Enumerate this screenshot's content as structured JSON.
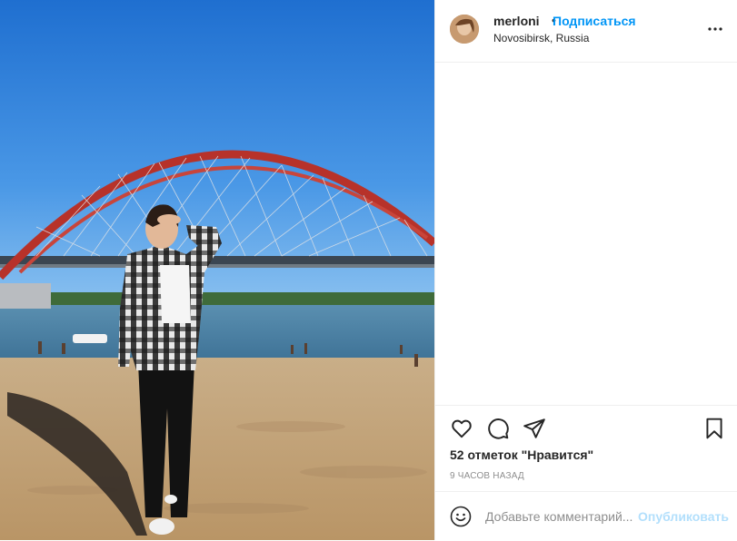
{
  "post": {
    "username": "merloni",
    "separator": "•",
    "follow_label": "Подписаться",
    "location": "Novosibirsk, Russia",
    "likes_text": "52 отметок \"Нравится\"",
    "time_text": "9 часов назад",
    "comment_placeholder": "Добавьте комментарий...",
    "publish_label": "Опубликовать"
  },
  "icons": {
    "more": "more-options-icon",
    "like": "heart-icon",
    "comment": "comment-icon",
    "share": "share-icon",
    "save": "bookmark-icon",
    "emoji": "emoji-icon"
  },
  "colors": {
    "accent": "#0095f6",
    "publish_disabled": "#b2dffc",
    "text": "#262626",
    "muted": "#8e8e8e"
  }
}
